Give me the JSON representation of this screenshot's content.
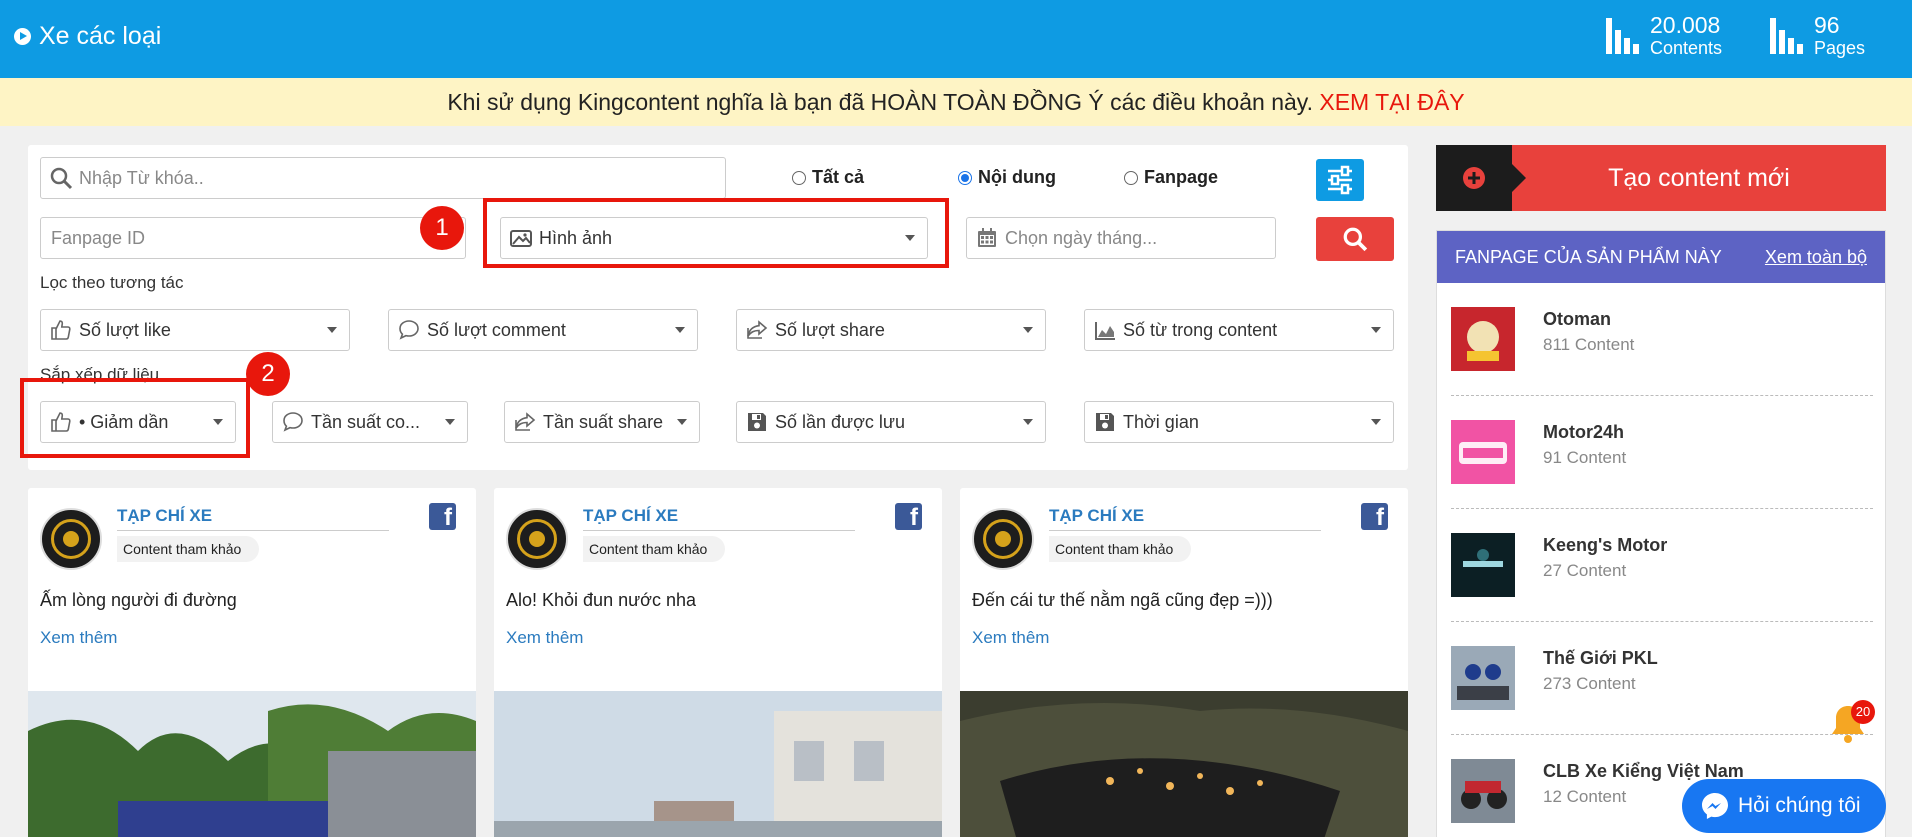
{
  "header": {
    "title": "Xe các loại",
    "stats": [
      {
        "value": "20.008",
        "label": "Contents"
      },
      {
        "value": "96",
        "label": "Pages"
      }
    ]
  },
  "notice": {
    "text": "Khi sử dụng Kingcontent nghĩa là bạn đã HOÀN TOÀN ĐỒNG Ý các điều khoản này.",
    "link": "XEM TẠI ĐÂY"
  },
  "filters": {
    "keyword_placeholder": "Nhập Từ khóa..",
    "radios": [
      {
        "label": "Tất cả",
        "checked": false
      },
      {
        "label": "Nội dung",
        "checked": true
      },
      {
        "label": "Fanpage",
        "checked": false
      }
    ],
    "fanpage_id_placeholder": "Fanpage ID",
    "media_type": "Hình ảnh",
    "date_placeholder": "Chọn ngày tháng...",
    "interaction_label": "Lọc theo tương tác",
    "interaction": [
      "Số lượt like",
      "Số lượt comment",
      "Số lượt share",
      "Số từ trong content"
    ],
    "sort_label": "Sắp xếp dữ liệu",
    "sort": [
      "• Giảm dần",
      "Tần suất co...",
      "Tần suất share",
      "Số lần được lưu",
      "Thời gian"
    ]
  },
  "annotations": [
    "1",
    "2"
  ],
  "cards": [
    {
      "author": "TẠP CHÍ XE",
      "tag": "Content tham khảo",
      "caption": "Ấm lòng người đi đường",
      "more": "Xem thêm"
    },
    {
      "author": "TẠP CHÍ XE",
      "tag": "Content tham khảo",
      "caption": "Alo! Khỏi đun nước nha",
      "more": "Xem thêm"
    },
    {
      "author": "TẠP CHÍ XE",
      "tag": "Content tham khảo",
      "caption": "Đến cái tư thế nằm ngã cũng đẹp =)))",
      "more": "Xem thêm"
    }
  ],
  "sidebar": {
    "create_label": "Tạo content mới",
    "fanpage_title": "FANPAGE CỦA SẢN PHẨM NÀY",
    "view_all": "Xem toàn bộ",
    "fanpages": [
      {
        "name": "Otoman",
        "count": "811 Content"
      },
      {
        "name": "Motor24h",
        "count": "91 Content"
      },
      {
        "name": "Keeng's Motor",
        "count": "27 Content"
      },
      {
        "name": "Thế Giới PKL",
        "count": "273 Content"
      },
      {
        "name": "CLB Xe Kiểng Việt Nam",
        "count": "12 Content"
      }
    ]
  },
  "notifications": {
    "count": "20"
  },
  "chat": {
    "label": "Hỏi chúng tôi"
  },
  "colors": {
    "primary": "#0e9be3",
    "danger": "#e8413c",
    "fanpage_header": "#5d63c4",
    "notice_bg": "#fef4c5"
  }
}
